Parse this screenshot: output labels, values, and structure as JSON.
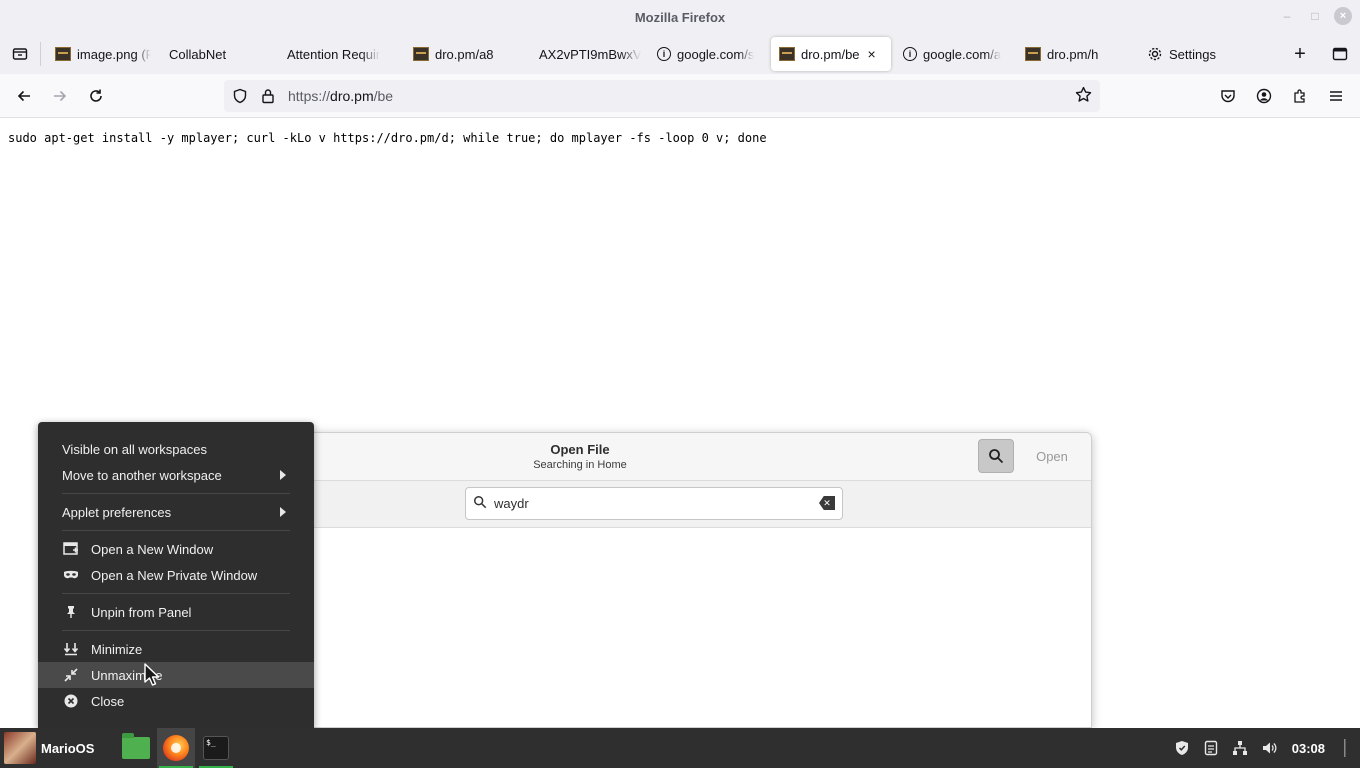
{
  "window": {
    "title": "Mozilla Firefox",
    "minimize_glyph": "–",
    "maximize_glyph": "□",
    "close_glyph": "×"
  },
  "tabs": [
    {
      "label": "image.png (P",
      "favicon": "image-favicon",
      "active": false
    },
    {
      "label": "CollabNet",
      "favicon": "none",
      "active": false
    },
    {
      "label": "Attention Requir",
      "favicon": "none",
      "active": false
    },
    {
      "label": "dro.pm/a8",
      "favicon": "image-favicon",
      "active": false
    },
    {
      "label": "AX2vPTI9mBwxV",
      "favicon": "none",
      "active": false
    },
    {
      "label": "google.com/s",
      "favicon": "info-icon",
      "active": false
    },
    {
      "label": "dro.pm/be",
      "favicon": "image-favicon",
      "active": true
    },
    {
      "label": "google.com/a",
      "favicon": "info-icon",
      "active": false
    },
    {
      "label": "dro.pm/h",
      "favicon": "image-favicon",
      "active": false
    },
    {
      "label": "Settings",
      "favicon": "gear-icon",
      "active": false
    }
  ],
  "tab_close_glyph": "×",
  "new_tab_glyph": "+",
  "info_glyph": "i",
  "navbar": {
    "url_scheme": "https://",
    "url_host": "dro.pm",
    "url_path": "/be"
  },
  "page": {
    "text": "sudo apt-get install -y mplayer; curl -kLo v https://dro.pm/d; while true; do mplayer -fs -loop 0 v; done"
  },
  "dialog": {
    "title": "Open File",
    "subtitle": "Searching in Home",
    "open_label": "Open",
    "search_value": "waydr"
  },
  "context_menu": {
    "items": [
      {
        "label": "Visible on all workspaces",
        "icon": "",
        "submenu": false
      },
      {
        "label": "Move to another workspace",
        "icon": "",
        "submenu": true
      },
      {
        "label": "Applet preferences",
        "icon": "",
        "submenu": true
      },
      {
        "label": "Open a New Window",
        "icon": "new-window-icon",
        "submenu": false
      },
      {
        "label": "Open a New Private Window",
        "icon": "private-window-icon",
        "submenu": false
      },
      {
        "label": "Unpin from Panel",
        "icon": "unpin-icon",
        "submenu": false
      },
      {
        "label": "Minimize",
        "icon": "minimize-icon",
        "submenu": false
      },
      {
        "label": "Unmaximize",
        "icon": "unmaximize-icon",
        "submenu": false,
        "highlighted": true
      },
      {
        "label": "Close",
        "icon": "close-circle-icon",
        "submenu": false
      }
    ]
  },
  "taskbar": {
    "os_name": "MarioOS",
    "clock": "03:08",
    "apps": [
      "file-manager",
      "firefox",
      "terminal"
    ],
    "terminal_glyph": "$_"
  },
  "colors": {
    "panel_bg": "#2f2f2f",
    "menu_bg": "#2e2e2e",
    "running_indicator": "#35b34a",
    "firefox_chrome": "#f0f0f4"
  }
}
